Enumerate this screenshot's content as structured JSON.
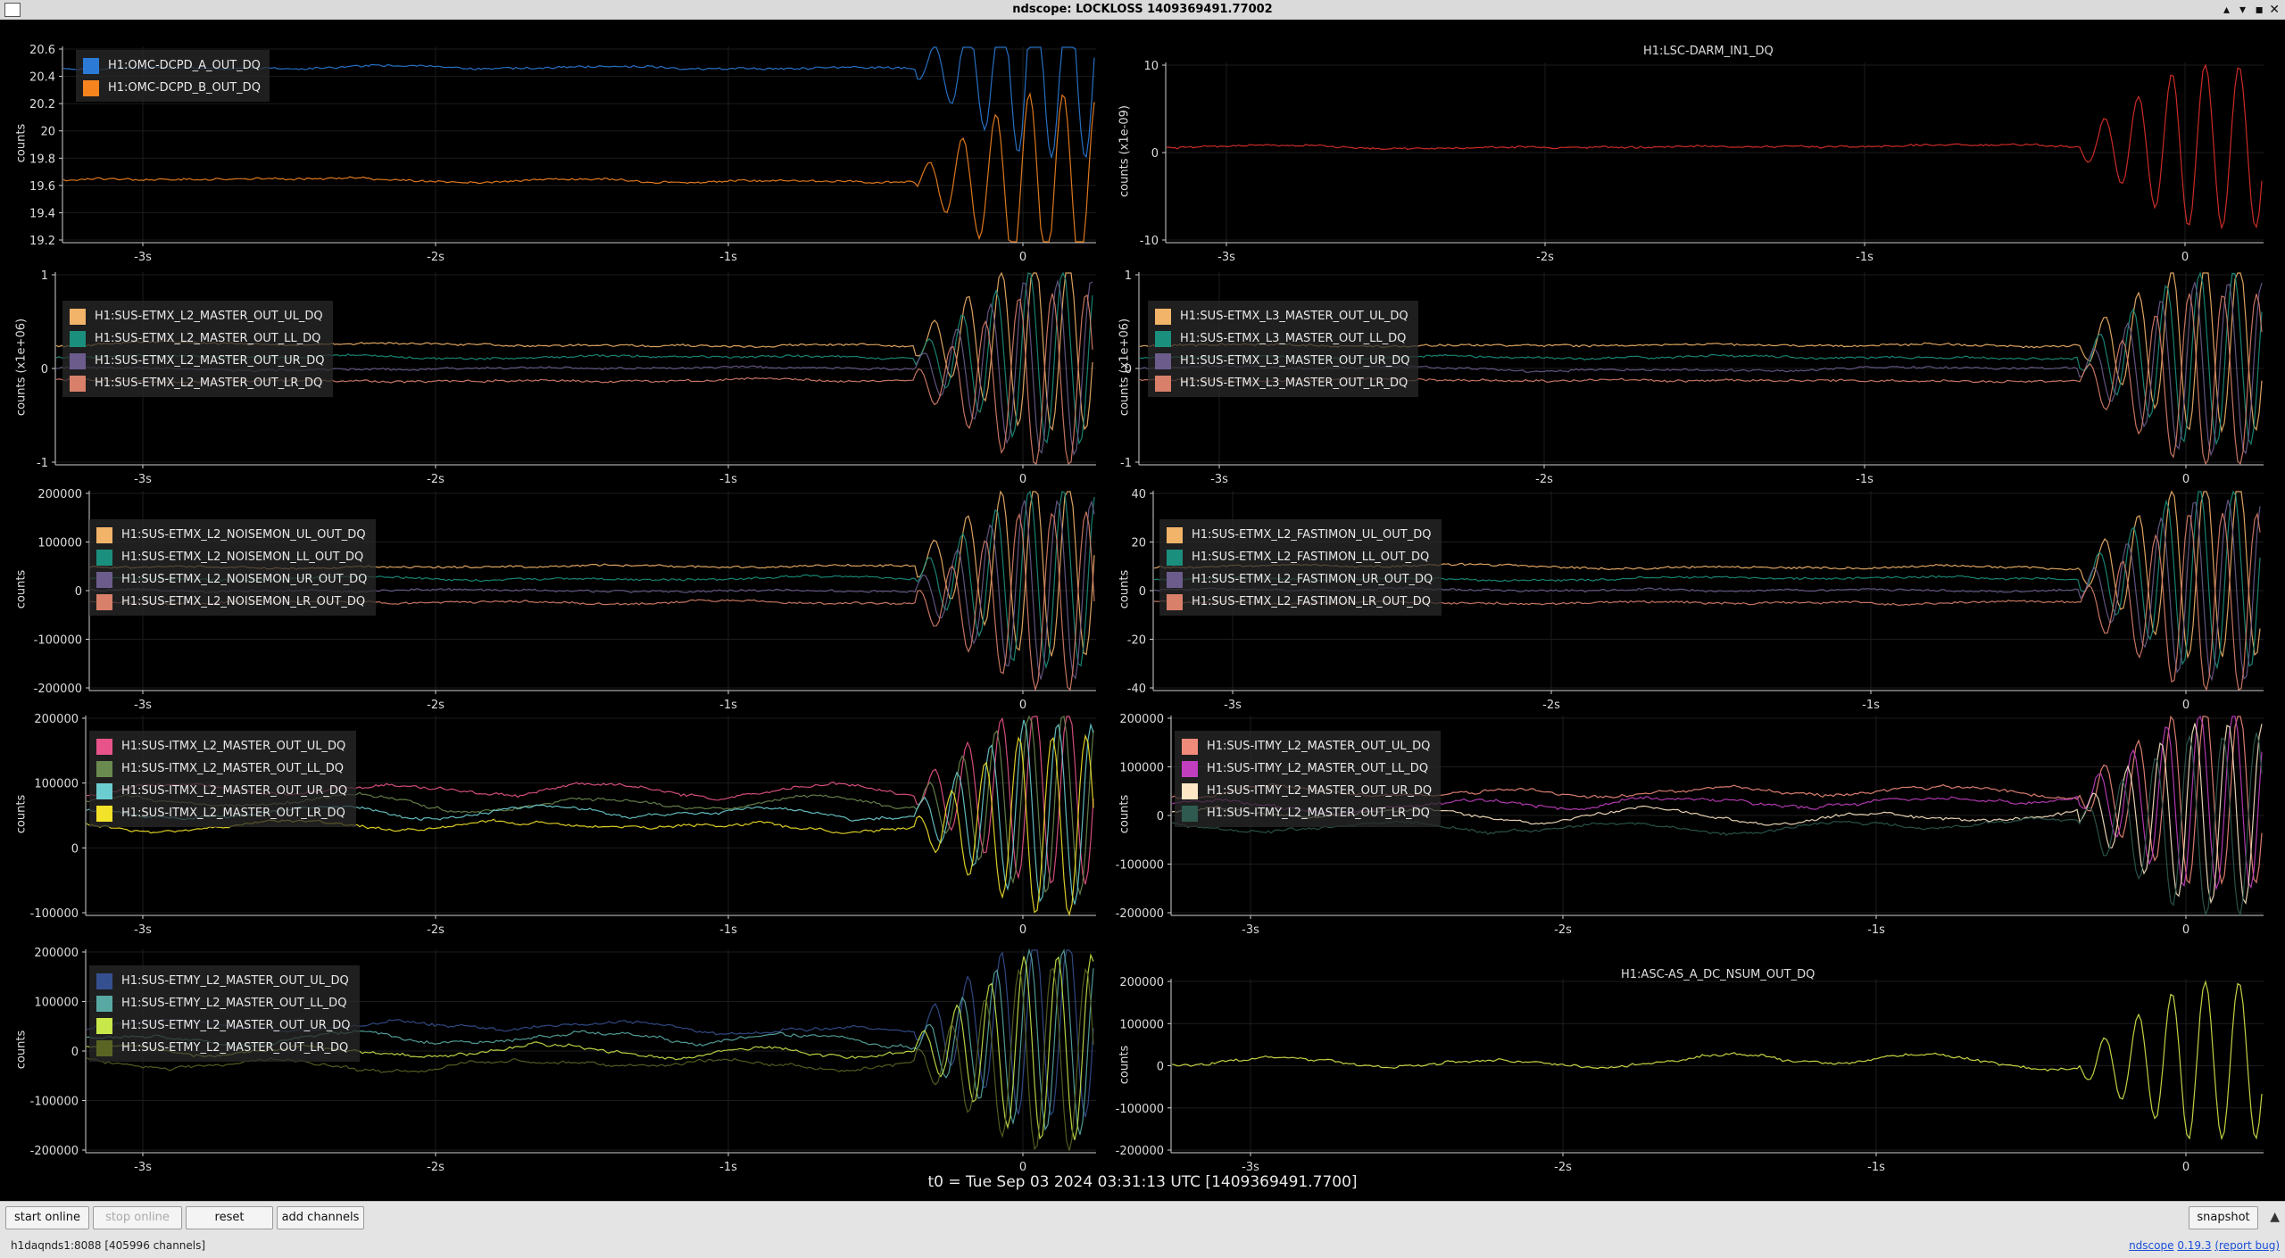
{
  "window": {
    "title": "ndscope: LOCKLOSS 1409369491.77002",
    "controls": [
      "▴",
      "▾",
      "▪",
      "✕"
    ]
  },
  "plots": [
    {
      "id": "p1",
      "title": "",
      "ylabel": "counts",
      "yticks": [
        "20.6",
        "20.4",
        "20.2",
        "20",
        "19.8",
        "19.6",
        "19.4",
        "19.2"
      ],
      "xticks": [
        "-3s",
        "-2s",
        "-1s",
        "0"
      ],
      "legend": [
        {
          "label": "H1:OMC-DCPD_A_OUT_DQ",
          "color": "#2b7bd6"
        },
        {
          "label": "H1:OMC-DCPD_B_OUT_DQ",
          "color": "#f5841f"
        }
      ]
    },
    {
      "id": "p2",
      "title": "H1:LSC-DARM_IN1_DQ",
      "ylabel": "counts (x1e-09)",
      "yticks": [
        "10",
        "0",
        "-10"
      ],
      "xticks": [
        "-3s",
        "-2s",
        "-1s",
        "0"
      ],
      "legend": []
    },
    {
      "id": "p3",
      "title": "",
      "ylabel": "counts (x1e+06)",
      "yticks": [
        "1",
        "0",
        "-1"
      ],
      "xticks": [
        "-3s",
        "-2s",
        "-1s",
        "0"
      ],
      "legend": [
        {
          "label": "H1:SUS-ETMX_L2_MASTER_OUT_UL_DQ",
          "color": "#f2b469"
        },
        {
          "label": "H1:SUS-ETMX_L2_MASTER_OUT_LL_DQ",
          "color": "#1b8f7d"
        },
        {
          "label": "H1:SUS-ETMX_L2_MASTER_OUT_UR_DQ",
          "color": "#6c5c8c"
        },
        {
          "label": "H1:SUS-ETMX_L2_MASTER_OUT_LR_DQ",
          "color": "#d9806a"
        }
      ]
    },
    {
      "id": "p4",
      "title": "",
      "ylabel": "counts (x1e+06)",
      "yticks": [
        "1",
        "0",
        "-1"
      ],
      "xticks": [
        "-3s",
        "-2s",
        "-1s",
        "0"
      ],
      "legend": [
        {
          "label": "H1:SUS-ETMX_L3_MASTER_OUT_UL_DQ",
          "color": "#f2b469"
        },
        {
          "label": "H1:SUS-ETMX_L3_MASTER_OUT_LL_DQ",
          "color": "#1b8f7d"
        },
        {
          "label": "H1:SUS-ETMX_L3_MASTER_OUT_UR_DQ",
          "color": "#6c5c8c"
        },
        {
          "label": "H1:SUS-ETMX_L3_MASTER_OUT_LR_DQ",
          "color": "#d9806a"
        }
      ]
    },
    {
      "id": "p5",
      "title": "",
      "ylabel": "counts",
      "yticks": [
        "200000",
        "100000",
        "0",
        "-100000",
        "-200000"
      ],
      "xticks": [
        "-3s",
        "-2s",
        "-1s",
        "0"
      ],
      "legend": [
        {
          "label": "H1:SUS-ETMX_L2_NOISEMON_UL_OUT_DQ",
          "color": "#f2b469"
        },
        {
          "label": "H1:SUS-ETMX_L2_NOISEMON_LL_OUT_DQ",
          "color": "#1b8f7d"
        },
        {
          "label": "H1:SUS-ETMX_L2_NOISEMON_UR_OUT_DQ",
          "color": "#6c5c8c"
        },
        {
          "label": "H1:SUS-ETMX_L2_NOISEMON_LR_OUT_DQ",
          "color": "#d9806a"
        }
      ]
    },
    {
      "id": "p6",
      "title": "",
      "ylabel": "counts",
      "yticks": [
        "40",
        "20",
        "0",
        "-20",
        "-40"
      ],
      "xticks": [
        "-3s",
        "-2s",
        "-1s",
        "0"
      ],
      "legend": [
        {
          "label": "H1:SUS-ETMX_L2_FASTIMON_UL_OUT_DQ",
          "color": "#f2b469"
        },
        {
          "label": "H1:SUS-ETMX_L2_FASTIMON_LL_OUT_DQ",
          "color": "#1b8f7d"
        },
        {
          "label": "H1:SUS-ETMX_L2_FASTIMON_UR_OUT_DQ",
          "color": "#6c5c8c"
        },
        {
          "label": "H1:SUS-ETMX_L2_FASTIMON_LR_OUT_DQ",
          "color": "#d9806a"
        }
      ]
    },
    {
      "id": "p7",
      "title": "",
      "ylabel": "counts",
      "yticks": [
        "200000",
        "100000",
        "0",
        "-100000"
      ],
      "xticks": [
        "-3s",
        "-2s",
        "-1s",
        "0"
      ],
      "legend": [
        {
          "label": "H1:SUS-ITMX_L2_MASTER_OUT_UL_DQ",
          "color": "#e8548a"
        },
        {
          "label": "H1:SUS-ITMX_L2_MASTER_OUT_LL_DQ",
          "color": "#6b8a4f"
        },
        {
          "label": "H1:SUS-ITMX_L2_MASTER_OUT_UR_DQ",
          "color": "#6ccdd0"
        },
        {
          "label": "H1:SUS-ITMX_L2_MASTER_OUT_LR_DQ",
          "color": "#f2e22a"
        }
      ]
    },
    {
      "id": "p8",
      "title": "",
      "ylabel": "counts",
      "yticks": [
        "200000",
        "100000",
        "0",
        "-100000",
        "-200000"
      ],
      "xticks": [
        "-3s",
        "-2s",
        "-1s",
        "0"
      ],
      "legend": [
        {
          "label": "H1:SUS-ITMY_L2_MASTER_OUT_UL_DQ",
          "color": "#f08a7a"
        },
        {
          "label": "H1:SUS-ITMY_L2_MASTER_OUT_LL_DQ",
          "color": "#c13fbf"
        },
        {
          "label": "H1:SUS-ITMY_L2_MASTER_OUT_UR_DQ",
          "color": "#fde7c4"
        },
        {
          "label": "H1:SUS-ITMY_L2_MASTER_OUT_LR_DQ",
          "color": "#2e5a50"
        }
      ]
    },
    {
      "id": "p9",
      "title": "",
      "ylabel": "counts",
      "yticks": [
        "200000",
        "100000",
        "0",
        "-100000",
        "-200000"
      ],
      "xticks": [
        "-3s",
        "-2s",
        "-1s",
        "0"
      ],
      "legend": [
        {
          "label": "H1:SUS-ETMY_L2_MASTER_OUT_UL_DQ",
          "color": "#35508f"
        },
        {
          "label": "H1:SUS-ETMY_L2_MASTER_OUT_LL_DQ",
          "color": "#58a9a3"
        },
        {
          "label": "H1:SUS-ETMY_L2_MASTER_OUT_UR_DQ",
          "color": "#c8e84a"
        },
        {
          "label": "H1:SUS-ETMY_L2_MASTER_OUT_LR_DQ",
          "color": "#5a6524"
        }
      ]
    },
    {
      "id": "p10",
      "title": "H1:ASC-AS_A_DC_NSUM_OUT_DQ",
      "ylabel": "counts",
      "yticks": [
        "200000",
        "100000",
        "0",
        "-100000",
        "-200000"
      ],
      "xticks": [
        "-3s",
        "-2s",
        "-1s",
        "0"
      ],
      "legend": []
    }
  ],
  "t0": "t0 = Tue Sep 03 2024 03:31:13 UTC [1409369491.7700]",
  "toolbar": {
    "start_online": "start online",
    "stop_online": "stop online",
    "reset": "reset",
    "add_channels": "add channels",
    "snapshot": "snapshot"
  },
  "status": "h1daqnds1:8088  [405996 channels]",
  "version": {
    "app": "ndscope",
    "number": "0.19.3",
    "report": "(report bug)"
  }
}
